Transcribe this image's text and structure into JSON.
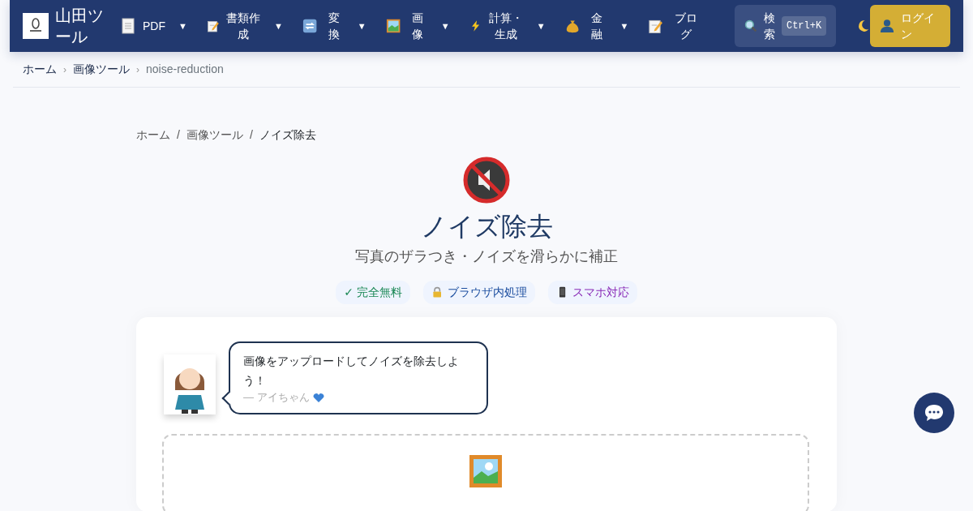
{
  "brand": {
    "name": "山田ツール"
  },
  "nav": [
    {
      "kind": "document",
      "label": "PDF",
      "caret": "▼"
    },
    {
      "kind": "memo",
      "label": "書類作成",
      "caret": "▼"
    },
    {
      "kind": "arrows",
      "label": "変換",
      "caret": "▼"
    },
    {
      "kind": "picture",
      "label": "画像",
      "caret": "▼"
    },
    {
      "kind": "bolt",
      "label": "計算・生成",
      "caret": "▼"
    },
    {
      "kind": "money",
      "label": "金融",
      "caret": "▼"
    },
    {
      "kind": "memo",
      "label": "ブログ"
    }
  ],
  "search": {
    "label": "検索",
    "shortcut": "Ctrl+K"
  },
  "login": {
    "label": "ログイン"
  },
  "top_breadcrumb": {
    "separator": "›",
    "items": [
      "ホーム",
      "画像ツール",
      "noise-reduction"
    ]
  },
  "breadcrumb": {
    "separator": "/",
    "items": [
      "ホーム",
      "画像ツール",
      "ノイズ除去"
    ]
  },
  "title": "ノイズ除去",
  "subtitle": "写真のザラつき・ノイズを滑らかに補正",
  "badges": [
    {
      "kind": "plain",
      "label": "✓ 完全無料",
      "color": "#198754"
    },
    {
      "kind": "lock",
      "label": "ブラウザ内処理",
      "color": "#1e4fa0"
    },
    {
      "kind": "phone",
      "label": "スマホ対応",
      "color": "#8a2db8"
    }
  ],
  "speech": {
    "text": "画像をアップロードしてノイズを除去しよう！",
    "author": "― アイちゃん"
  }
}
